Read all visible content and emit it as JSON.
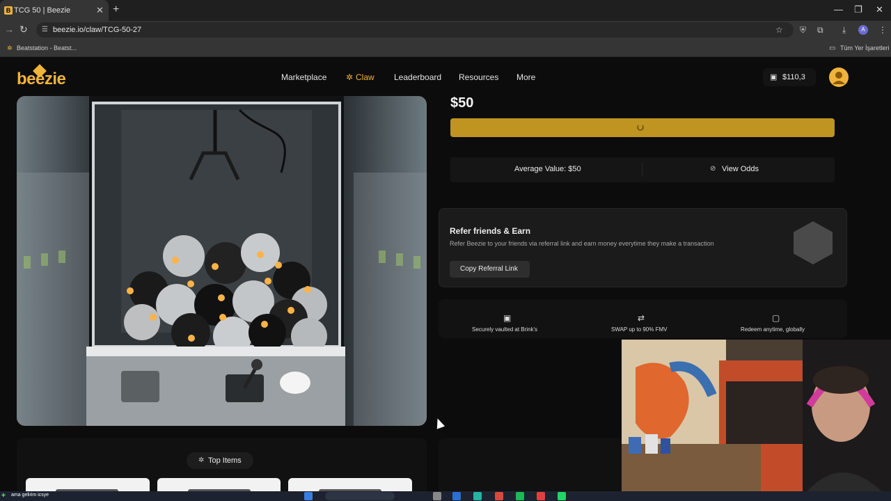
{
  "browser": {
    "tab_title": "TCG 50 | Beezie",
    "url": "beezie.io/claw/TCG-50-27",
    "bookmarks": [
      "Beatstation - Beatst...",
      "Tüm Yer İşaretleri"
    ]
  },
  "site": {
    "logo_text": "beezie",
    "nav": [
      "Marketplace",
      "Claw",
      "Leaderboard",
      "Resources",
      "More"
    ],
    "active_nav": "Claw",
    "wallet_balance": "$110,3",
    "accent_color": "#f0b43c"
  },
  "claw": {
    "price": "$50",
    "average_value": "Average Value: $50",
    "view_odds": "View Odds"
  },
  "referral": {
    "title": "Refer friends & Earn",
    "description": "Refer Beezie to your friends via referral link and earn money everytime they make a transaction",
    "button": "Copy Referral Link"
  },
  "features": [
    {
      "icon": "vault-icon",
      "label": "Securely vaulted at Brink's"
    },
    {
      "icon": "swap-icon",
      "label": "SWAP up to 90% FMV"
    },
    {
      "icon": "redeem-icon",
      "label": "Redeem anytime, globally"
    }
  ],
  "bottom": {
    "top_items_label": "Top Items"
  },
  "taskbar": {
    "notification_text": "ama gelirim icsye"
  }
}
